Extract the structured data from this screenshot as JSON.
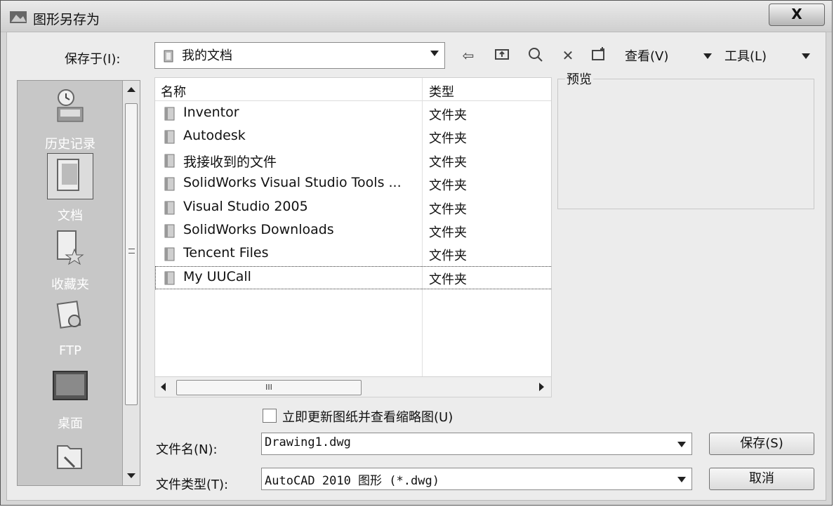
{
  "window": {
    "title": "图形另存为",
    "close_label": "X"
  },
  "save_in": {
    "label": "保存于(I):",
    "value": "我的文档"
  },
  "toolbar": {
    "views_label": "查看(V)",
    "tools_label": "工具(L)"
  },
  "places": [
    {
      "label": "历史记录",
      "icon": "history-icon"
    },
    {
      "label": "文档",
      "icon": "documents-icon"
    },
    {
      "label": "收藏夹",
      "icon": "favorites-icon"
    },
    {
      "label": "FTP",
      "icon": "ftp-icon"
    },
    {
      "label": "桌面",
      "icon": "desktop-icon"
    }
  ],
  "filelist": {
    "columns": [
      "名称",
      "类型"
    ],
    "rows": [
      {
        "name": "Inventor",
        "type": "文件夹"
      },
      {
        "name": "Autodesk",
        "type": "文件夹"
      },
      {
        "name": "我接收到的文件",
        "type": "文件夹"
      },
      {
        "name": "SolidWorks Visual Studio Tools ...",
        "type": "文件夹"
      },
      {
        "name": "Visual Studio 2005",
        "type": "文件夹"
      },
      {
        "name": "SolidWorks Downloads",
        "type": "文件夹"
      },
      {
        "name": "Tencent Files",
        "type": "文件夹"
      },
      {
        "name": "My UUCall",
        "type": "文件夹"
      }
    ],
    "hscroll_thumb": "III"
  },
  "preview": {
    "label": "预览"
  },
  "update_thumbnail": {
    "label": "立即更新图纸并查看缩略图(U)",
    "checked": false
  },
  "filename": {
    "label": "文件名(N):",
    "value": "Drawing1.dwg"
  },
  "filetype": {
    "label": "文件类型(T):",
    "value": "AutoCAD 2010 图形 (*.dwg)"
  },
  "buttons": {
    "save": "保存(S)",
    "cancel": "取消"
  }
}
